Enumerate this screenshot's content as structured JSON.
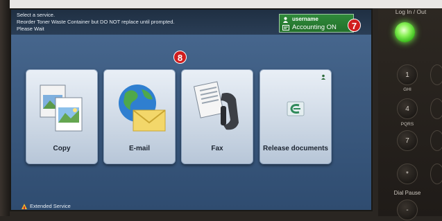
{
  "status_messages": [
    "Select a service.",
    "Reorder Toner Waste Container but DO NOT replace until prompted.",
    "Please Wait"
  ],
  "user": {
    "name": "username",
    "accounting": "Accounting ON"
  },
  "callouts": {
    "seven": "7",
    "eight": "8"
  },
  "services": [
    {
      "label": "Copy",
      "icon": "copy-icon"
    },
    {
      "label": "E-mail",
      "icon": "email-icon"
    },
    {
      "label": "Fax",
      "icon": "fax-icon"
    },
    {
      "label": "Release documents",
      "icon": "release-documents-icon"
    }
  ],
  "footer": {
    "extended_service": "Extended Service"
  },
  "control_panel": {
    "login_label": "Log In / Out",
    "keys": [
      "1",
      "4",
      "7",
      "*",
      "-"
    ],
    "key_letters": [
      "GHI",
      "PQRS"
    ],
    "dial_pause": "Dial Pause"
  },
  "colors": {
    "screen": "#3e5d83",
    "accounting_box": "#2f8a3a",
    "callout": "#d11e1e",
    "led": "#8cf25a"
  }
}
